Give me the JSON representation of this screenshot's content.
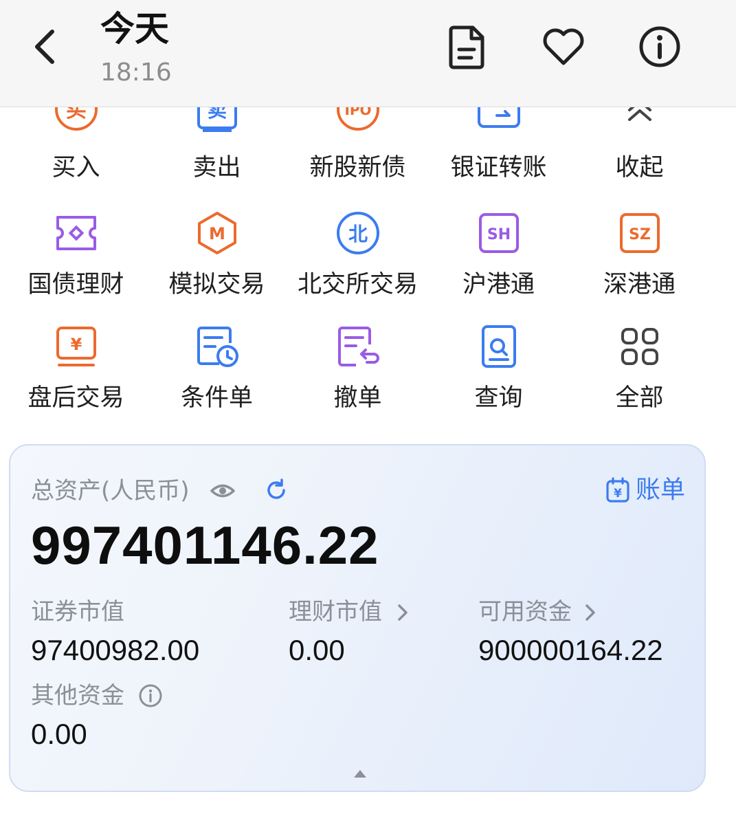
{
  "header": {
    "title": "今天",
    "subtitle": "18:16"
  },
  "actions": [
    {
      "label": "买入",
      "icon": "buy-icon",
      "glyph": "买"
    },
    {
      "label": "卖出",
      "icon": "sell-icon",
      "glyph": "卖"
    },
    {
      "label": "新股新债",
      "icon": "ipo-icon",
      "glyph": "IPO"
    },
    {
      "label": "银证转账",
      "icon": "card-transfer-icon"
    },
    {
      "label": "收起",
      "icon": "collapse-icon"
    },
    {
      "label": "国债理财",
      "icon": "ticket-icon"
    },
    {
      "label": "模拟交易",
      "icon": "simulated-trade-icon",
      "glyph": "M"
    },
    {
      "label": "北交所交易",
      "icon": "bse-icon",
      "glyph": "北"
    },
    {
      "label": "沪港通",
      "icon": "sh-connect-icon",
      "glyph": "SH"
    },
    {
      "label": "深港通",
      "icon": "sz-connect-icon",
      "glyph": "SZ"
    },
    {
      "label": "盘后交易",
      "icon": "after-hours-icon",
      "glyph": "¥"
    },
    {
      "label": "条件单",
      "icon": "conditional-order-icon"
    },
    {
      "label": "撤单",
      "icon": "cancel-order-icon"
    },
    {
      "label": "查询",
      "icon": "query-icon"
    },
    {
      "label": "全部",
      "icon": "all-grid-icon"
    }
  ],
  "assets": {
    "total_label": "总资产(人民币)",
    "total_value": "997401146.22",
    "bill_label": "账单",
    "bill_glyph": "¥",
    "securities_label": "证券市值",
    "securities_value": "97400982.00",
    "wealth_label": "理财市值",
    "wealth_value": "0.00",
    "available_label": "可用资金",
    "available_value": "900000164.22",
    "other_label": "其他资金",
    "other_value": "0.00"
  },
  "colors": {
    "orange": "#ec6a2e",
    "blue": "#3b7cf0",
    "purple": "#9a5be6",
    "gray_text": "#8a8f98"
  }
}
